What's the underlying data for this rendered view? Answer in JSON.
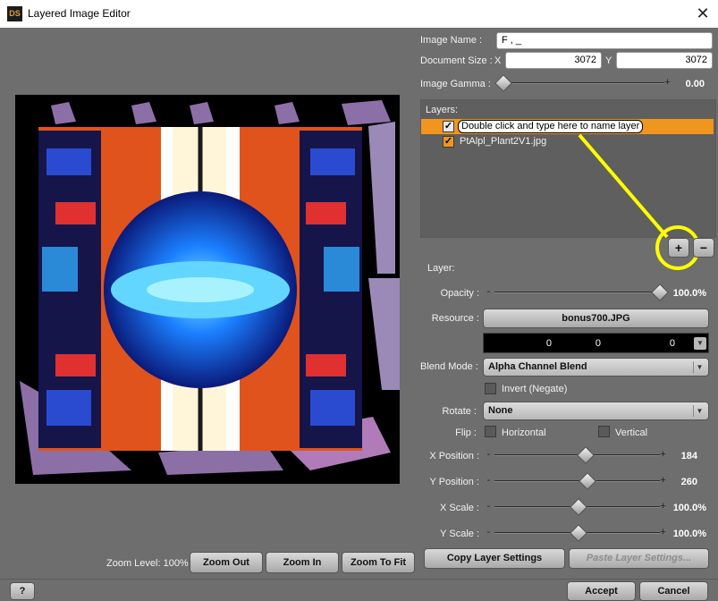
{
  "window": {
    "title": "Layered Image Editor",
    "logo_text": "DS"
  },
  "image": {
    "name_label": "Image Name :",
    "name_value": "F , _",
    "doc_size_label": "Document Size :",
    "x_label": "X",
    "x_value": "3072",
    "y_label": "Y",
    "y_value": "3072",
    "gamma_label": "Image Gamma :",
    "gamma_value": "0.00",
    "gamma_fraction": 0.0
  },
  "layers": {
    "label": "Layers:",
    "items": [
      {
        "name": "Double click and type here to name layer",
        "checked": true,
        "selected": true
      },
      {
        "name": "PtAlpl_Plant2V1.jpg",
        "checked": true,
        "selected": false
      }
    ],
    "add_label": "+",
    "remove_label": "−",
    "annotation_color": "#ffff00"
  },
  "layer": {
    "section_label": "Layer:",
    "opacity_label": "Opacity :",
    "opacity_value": "100.0%",
    "opacity_fraction": 1.0,
    "resource_label": "Resource :",
    "resource_value": "bonus700.JPG",
    "offsets": [
      "0",
      "0",
      "0"
    ],
    "blend_label": "Blend Mode :",
    "blend_value": "Alpha Channel Blend",
    "invert_label": "Invert (Negate)",
    "invert_checked": false,
    "rotate_label": "Rotate :",
    "rotate_value": "None",
    "flip_label": "Flip :",
    "flip_h_label": "Horizontal",
    "flip_v_label": "Vertical",
    "xpos_label": "X Position :",
    "xpos_value": "184",
    "xpos_fraction": 0.55,
    "ypos_label": "Y Position :",
    "ypos_value": "260",
    "ypos_fraction": 0.56,
    "xscale_label": "X Scale :",
    "xscale_value": "100.0%",
    "xscale_fraction": 0.51,
    "yscale_label": "Y Scale :",
    "yscale_value": "100.0%",
    "yscale_fraction": 0.51
  },
  "zoom": {
    "label": "Zoom Level: 100%",
    "zoom_out": "Zoom Out",
    "zoom_in": "Zoom In",
    "zoom_to_fit": "Zoom To Fit"
  },
  "actions": {
    "copy_settings": "Copy Layer Settings",
    "paste_settings": "Paste Layer Settings...",
    "help": "?",
    "accept": "Accept",
    "cancel": "Cancel"
  }
}
